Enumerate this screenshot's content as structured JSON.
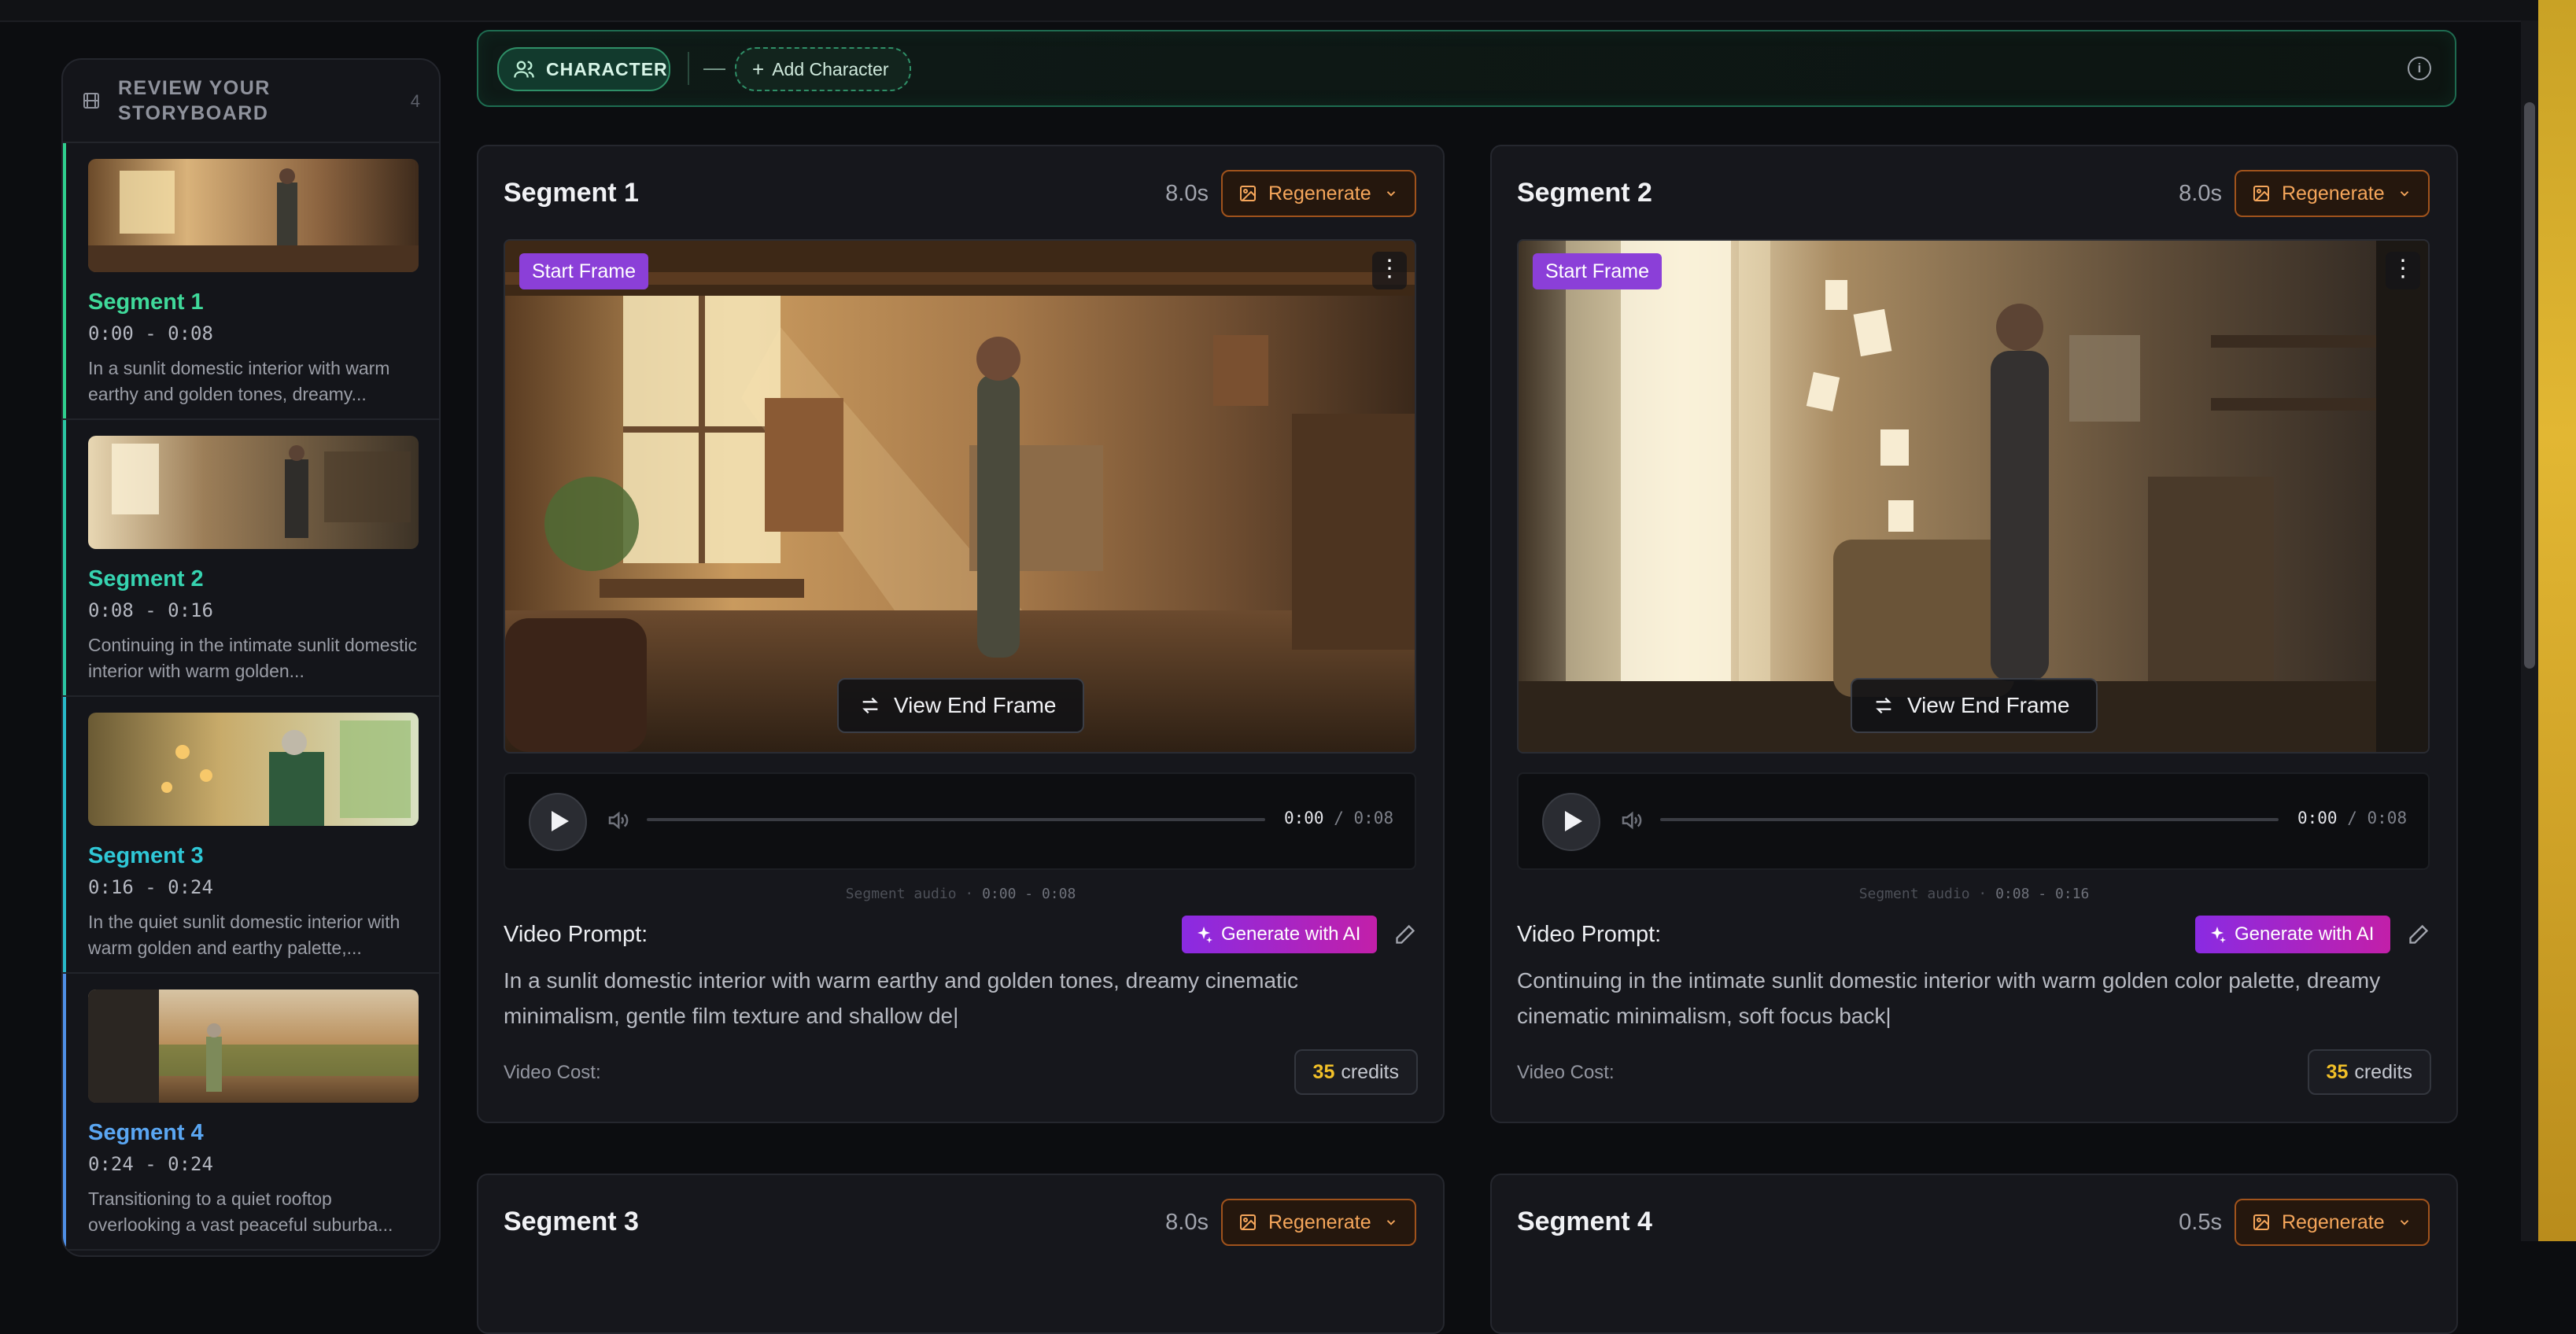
{
  "sidebar": {
    "title": "REVIEW YOUR STORYBOARD",
    "count": "4",
    "items": [
      {
        "name": "Segment 1",
        "time": "0:00 - 0:08",
        "desc": "In a sunlit domestic interior with warm earthy and golden tones, dreamy...",
        "color": "#3fd99a"
      },
      {
        "name": "Segment 2",
        "time": "0:08 - 0:16",
        "desc": "Continuing in the intimate sunlit domestic interior with warm golden...",
        "color": "#36d3b0"
      },
      {
        "name": "Segment 3",
        "time": "0:16 - 0:24",
        "desc": "In the quiet sunlit domestic interior with warm golden and earthy palette,...",
        "color": "#2fc7d6"
      },
      {
        "name": "Segment 4",
        "time": "0:24 - 0:24",
        "desc": "Transitioning to a quiet rooftop overlooking a vast peaceful suburba...",
        "color": "#5aa6f2"
      }
    ]
  },
  "characterbar": {
    "character_label": "CHARACTER",
    "dash": "—",
    "add_label": "Add Character",
    "info": "i"
  },
  "segments": [
    {
      "title": "Segment 1",
      "duration": "8.0s",
      "regenerate": "Regenerate",
      "start_tag": "Start Frame",
      "end_frame": "View End Frame",
      "time_current": "0:00",
      "time_sep": " / ",
      "time_total": "0:08",
      "audio_label": "Segment audio",
      "audio_range": "0:00 - 0:08",
      "prompt_label": "Video Prompt:",
      "generate": "Generate with AI",
      "prompt": "In a sunlit domestic interior with warm earthy and golden tones, dreamy cinematic minimalism, gentle film texture and shallow de|",
      "cost_label": "Video Cost:",
      "credits_value": "35",
      "credits_unit": "credits"
    },
    {
      "title": "Segment 2",
      "duration": "8.0s",
      "regenerate": "Regenerate",
      "start_tag": "Start Frame",
      "end_frame": "View End Frame",
      "time_current": "0:00",
      "time_sep": " / ",
      "time_total": "0:08",
      "audio_label": "Segment audio",
      "audio_range": "0:08 - 0:16",
      "prompt_label": "Video Prompt:",
      "generate": "Generate with AI",
      "prompt": "Continuing in the intimate sunlit domestic interior with warm golden color palette, dreamy cinematic minimalism, soft focus back|",
      "cost_label": "Video Cost:",
      "credits_value": "35",
      "credits_unit": "credits"
    },
    {
      "title": "Segment 3",
      "duration": "8.0s",
      "regenerate": "Regenerate"
    },
    {
      "title": "Segment 4",
      "duration": "0.5s",
      "regenerate": "Regenerate"
    }
  ]
}
